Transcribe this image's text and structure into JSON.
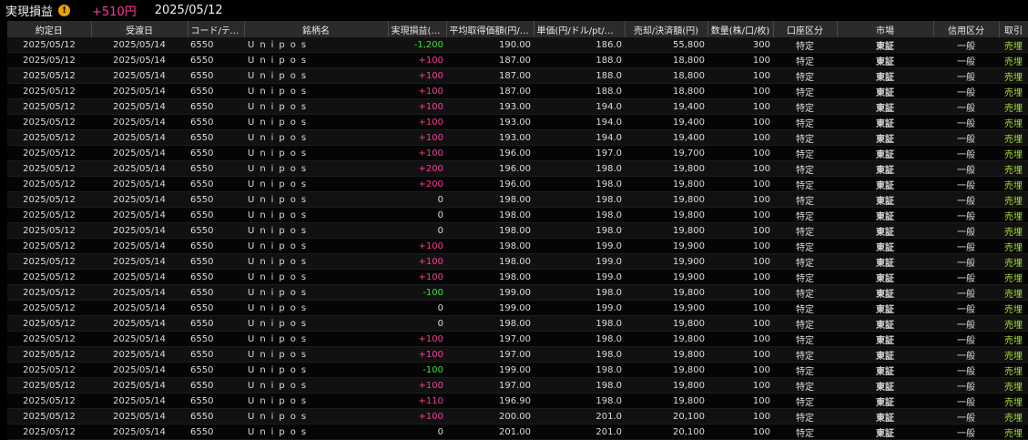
{
  "header": {
    "title": "実現損益",
    "warning_icon": "warning-icon",
    "total": "+510円",
    "date": "2025/05/12"
  },
  "columns": [
    "約定日",
    "受渡日",
    "コード/ティッ...",
    "銘柄名",
    "実現損益(円)",
    "平均取得価額(円/pt)",
    "単価(円/ドル/pt/そ...",
    "売却/決済額(円)",
    "数量(株/口/枚)",
    "口座区分",
    "市場",
    "信用区分",
    "取引"
  ],
  "rows": [
    [
      "2025/05/12",
      "2025/05/14",
      "6550",
      "Unipos",
      "-1,200",
      "190.00",
      "186.0",
      "55,800",
      "300",
      "特定",
      "東証",
      "一般",
      "売埋"
    ],
    [
      "2025/05/12",
      "2025/05/14",
      "6550",
      "Unipos",
      "+100",
      "187.00",
      "188.0",
      "18,800",
      "100",
      "特定",
      "東証",
      "一般",
      "売埋"
    ],
    [
      "2025/05/12",
      "2025/05/14",
      "6550",
      "Unipos",
      "+100",
      "187.00",
      "188.0",
      "18,800",
      "100",
      "特定",
      "東証",
      "一般",
      "売埋"
    ],
    [
      "2025/05/12",
      "2025/05/14",
      "6550",
      "Unipos",
      "+100",
      "187.00",
      "188.0",
      "18,800",
      "100",
      "特定",
      "東証",
      "一般",
      "売埋"
    ],
    [
      "2025/05/12",
      "2025/05/14",
      "6550",
      "Unipos",
      "+100",
      "193.00",
      "194.0",
      "19,400",
      "100",
      "特定",
      "東証",
      "一般",
      "売埋"
    ],
    [
      "2025/05/12",
      "2025/05/14",
      "6550",
      "Unipos",
      "+100",
      "193.00",
      "194.0",
      "19,400",
      "100",
      "特定",
      "東証",
      "一般",
      "売埋"
    ],
    [
      "2025/05/12",
      "2025/05/14",
      "6550",
      "Unipos",
      "+100",
      "193.00",
      "194.0",
      "19,400",
      "100",
      "特定",
      "東証",
      "一般",
      "売埋"
    ],
    [
      "2025/05/12",
      "2025/05/14",
      "6550",
      "Unipos",
      "+100",
      "196.00",
      "197.0",
      "19,700",
      "100",
      "特定",
      "東証",
      "一般",
      "売埋"
    ],
    [
      "2025/05/12",
      "2025/05/14",
      "6550",
      "Unipos",
      "+200",
      "196.00",
      "198.0",
      "19,800",
      "100",
      "特定",
      "東証",
      "一般",
      "売埋"
    ],
    [
      "2025/05/12",
      "2025/05/14",
      "6550",
      "Unipos",
      "+200",
      "196.00",
      "198.0",
      "19,800",
      "100",
      "特定",
      "東証",
      "一般",
      "売埋"
    ],
    [
      "2025/05/12",
      "2025/05/14",
      "6550",
      "Unipos",
      "0",
      "198.00",
      "198.0",
      "19,800",
      "100",
      "特定",
      "東証",
      "一般",
      "売埋"
    ],
    [
      "2025/05/12",
      "2025/05/14",
      "6550",
      "Unipos",
      "0",
      "198.00",
      "198.0",
      "19,800",
      "100",
      "特定",
      "東証",
      "一般",
      "売埋"
    ],
    [
      "2025/05/12",
      "2025/05/14",
      "6550",
      "Unipos",
      "0",
      "198.00",
      "198.0",
      "19,800",
      "100",
      "特定",
      "東証",
      "一般",
      "売埋"
    ],
    [
      "2025/05/12",
      "2025/05/14",
      "6550",
      "Unipos",
      "+100",
      "198.00",
      "199.0",
      "19,900",
      "100",
      "特定",
      "東証",
      "一般",
      "売埋"
    ],
    [
      "2025/05/12",
      "2025/05/14",
      "6550",
      "Unipos",
      "+100",
      "198.00",
      "199.0",
      "19,900",
      "100",
      "特定",
      "東証",
      "一般",
      "売埋"
    ],
    [
      "2025/05/12",
      "2025/05/14",
      "6550",
      "Unipos",
      "+100",
      "198.00",
      "199.0",
      "19,900",
      "100",
      "特定",
      "東証",
      "一般",
      "売埋"
    ],
    [
      "2025/05/12",
      "2025/05/14",
      "6550",
      "Unipos",
      "-100",
      "199.00",
      "198.0",
      "19,800",
      "100",
      "特定",
      "東証",
      "一般",
      "売埋"
    ],
    [
      "2025/05/12",
      "2025/05/14",
      "6550",
      "Unipos",
      "0",
      "199.00",
      "199.0",
      "19,900",
      "100",
      "特定",
      "東証",
      "一般",
      "売埋"
    ],
    [
      "2025/05/12",
      "2025/05/14",
      "6550",
      "Unipos",
      "0",
      "198.00",
      "198.0",
      "19,800",
      "100",
      "特定",
      "東証",
      "一般",
      "売埋"
    ],
    [
      "2025/05/12",
      "2025/05/14",
      "6550",
      "Unipos",
      "+100",
      "197.00",
      "198.0",
      "19,800",
      "100",
      "特定",
      "東証",
      "一般",
      "売埋"
    ],
    [
      "2025/05/12",
      "2025/05/14",
      "6550",
      "Unipos",
      "+100",
      "197.00",
      "198.0",
      "19,800",
      "100",
      "特定",
      "東証",
      "一般",
      "売埋"
    ],
    [
      "2025/05/12",
      "2025/05/14",
      "6550",
      "Unipos",
      "-100",
      "199.00",
      "198.0",
      "19,800",
      "100",
      "特定",
      "東証",
      "一般",
      "売埋"
    ],
    [
      "2025/05/12",
      "2025/05/14",
      "6550",
      "Unipos",
      "+100",
      "197.00",
      "198.0",
      "19,800",
      "100",
      "特定",
      "東証",
      "一般",
      "売埋"
    ],
    [
      "2025/05/12",
      "2025/05/14",
      "6550",
      "Unipos",
      "+110",
      "196.90",
      "198.0",
      "19,800",
      "100",
      "特定",
      "東証",
      "一般",
      "売埋"
    ],
    [
      "2025/05/12",
      "2025/05/14",
      "6550",
      "Unipos",
      "+100",
      "200.00",
      "201.0",
      "20,100",
      "100",
      "特定",
      "東証",
      "一般",
      "売埋"
    ],
    [
      "2025/05/12",
      "2025/05/14",
      "6550",
      "Unipos",
      "0",
      "201.00",
      "201.0",
      "20,100",
      "100",
      "特定",
      "東証",
      "一般",
      "売埋"
    ]
  ],
  "colors": {
    "positive": "#ff3a9a",
    "negative": "#3de03d",
    "trade": "#a6e22e",
    "header_bg": "#2b2b2b"
  }
}
